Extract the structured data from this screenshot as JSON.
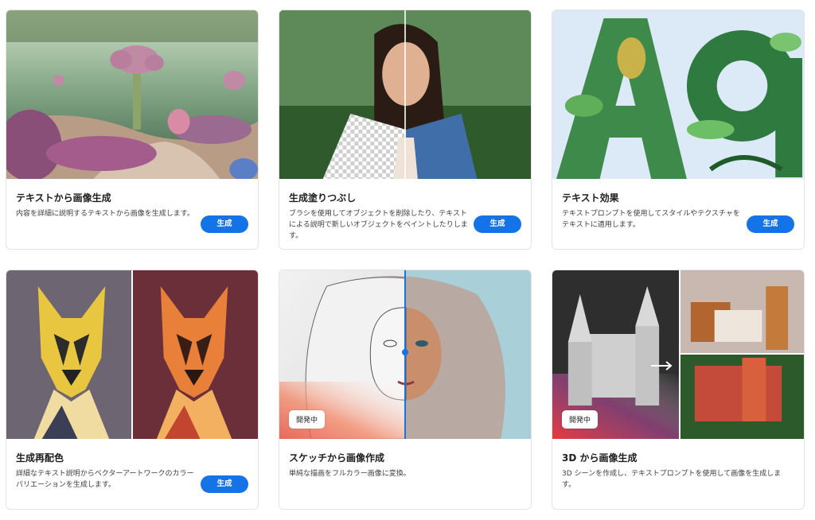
{
  "generate_label": "生成",
  "badge_label": "開発中",
  "cards": [
    {
      "title": "テキストから画像生成",
      "description": "内容を詳細に説明するテキストから画像を生成します。"
    },
    {
      "title": "生成塗りつぶし",
      "description": "ブラシを使用してオブジェクトを削除したり、テキストによる説明で新しいオブジェクトをペイントしたりします。"
    },
    {
      "title": "テキスト効果",
      "description": "テキストプロンプトを使用してスタイルやテクスチャをテキストに適用します。"
    },
    {
      "title": "生成再配色",
      "description": "詳細なテキスト説明からベクターアートワークのカラーバリエーションを生成します。"
    },
    {
      "title": "スケッチから画像作成",
      "description": "単純な描画をフルカラー画像に変換。"
    },
    {
      "title": "3D から画像生成",
      "description": "3D シーンを作成し、テキストプロンプトを使用して画像を生成します。"
    }
  ],
  "colors": {
    "accent": "#1473e6",
    "border": "#e4e4e4"
  }
}
